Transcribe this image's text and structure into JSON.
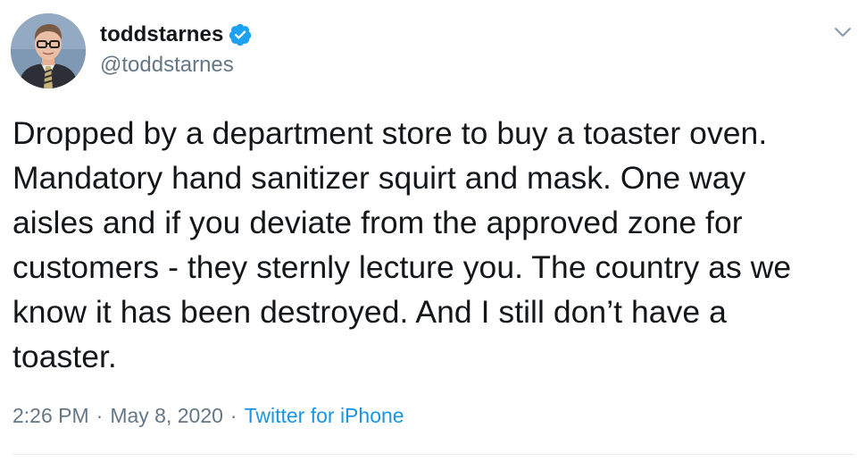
{
  "tweet": {
    "author": {
      "display_name": "toddstarnes",
      "handle": "@toddstarnes",
      "verified_icon": "verified-badge-icon",
      "avatar_icon": "avatar"
    },
    "menu_icon": "chevron-down-icon",
    "text": "Dropped by a department store to buy a toaster oven.\nMandatory hand sanitizer squirt and mask. One way\naisles and if you deviate from the approved zone for\ncustomers - they sternly lecture you. The country as we\nknow it has been destroyed. And I still don’t have a\ntoaster.",
    "meta": {
      "time": "2:26 PM",
      "separator_1": "·",
      "date": "May 8, 2020",
      "separator_2": "·",
      "source": "Twitter for iPhone"
    }
  },
  "colors": {
    "text": "#14171a",
    "secondary": "#657786",
    "link": "#1b95e0",
    "verified": "#1da1f2"
  }
}
